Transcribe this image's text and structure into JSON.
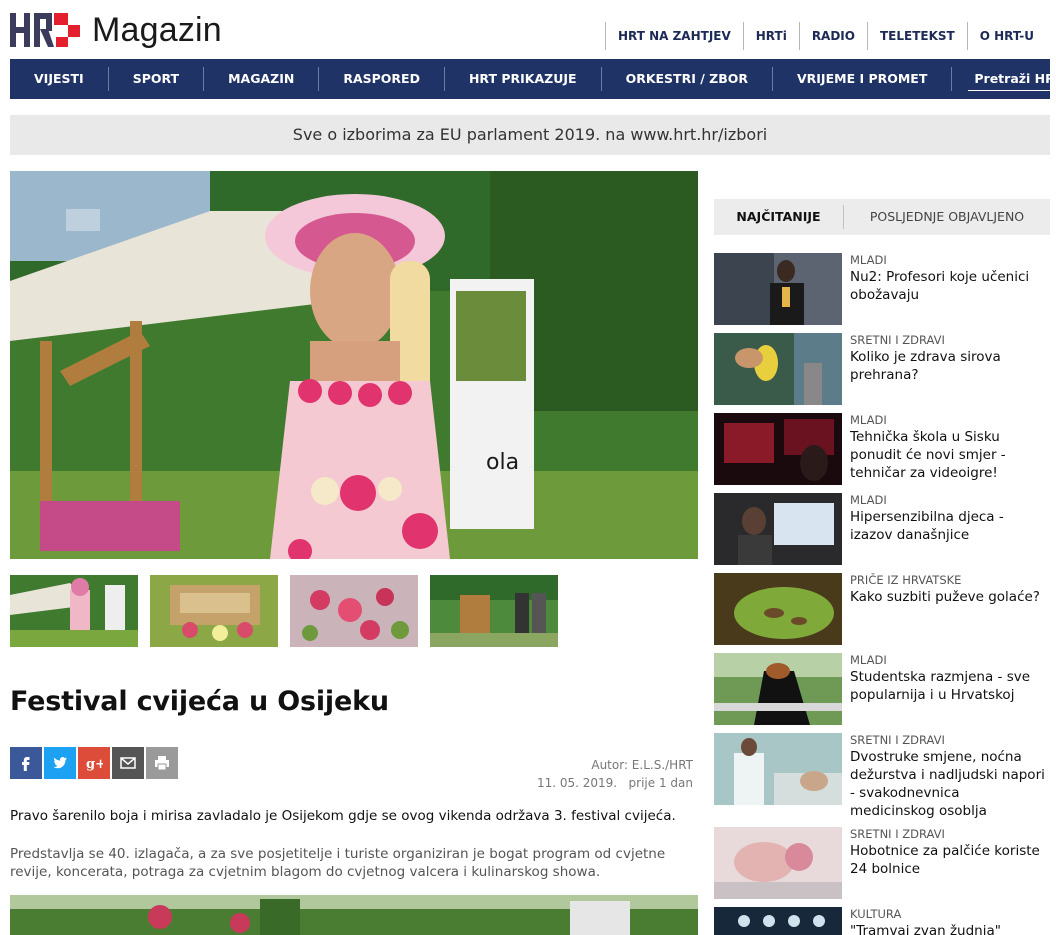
{
  "header": {
    "logo_text": "Magazin",
    "logo_mark": "HRT",
    "topnav": [
      "HRT NA ZAHTJEV",
      "HRTi",
      "RADIO",
      "TELETEKST",
      "O HRT-U"
    ]
  },
  "mainnav": {
    "items": [
      "VIJESTI",
      "SPORT",
      "MAGAZIN",
      "RASPORED",
      "HRT PRIKAZUJE",
      "ORKESTRI / ZBOR",
      "VRIJEME I PROMET"
    ],
    "search_placeholder": "Pretraži HRT"
  },
  "banner": {
    "text": "Sve o izborima za EU parlament 2019. na www.hrt.hr/izbori"
  },
  "article": {
    "title": "Festival cvijeća u Osijeku",
    "author": "Autor: E.L.S./HRT",
    "date": "11. 05. 2019.",
    "ago": "prije 1 dan",
    "lead": "Pravo šarenilo boja i mirisa zavladalo je Osijekom gdje se ovog vikenda održava 3. festival cvijeća.",
    "body": "Predstavlja se 40. izlagača, a za sve posjetitelje i turiste organiziran je bogat program od cvjetne revije, koncerata, potraga za cvjetnim blagom do cvjetnog valcera i kulinarskog showa."
  },
  "share": {
    "icons": [
      "facebook-icon",
      "twitter-icon",
      "google-plus-icon",
      "email-icon",
      "print-icon"
    ]
  },
  "sidebar": {
    "tabs": [
      "NAJČITANIJE",
      "POSLJEDNJE OBJAVLJENO"
    ],
    "items": [
      {
        "category": "MLADI",
        "title": "Nu2: Profesori koje učenici obožavaju"
      },
      {
        "category": "SRETNI I ZDRAVI",
        "title": "Koliko je zdrava sirova prehrana?"
      },
      {
        "category": "MLADI",
        "title": "Tehnička škola u Sisku ponudit će novi smjer - tehničar za videoigre!"
      },
      {
        "category": "MLADI",
        "title": "Hipersenzibilna djeca - izazov današnjice"
      },
      {
        "category": "PRIČE IZ HRVATSKE",
        "title": "Kako suzbiti puževe golaće?"
      },
      {
        "category": "MLADI",
        "title": "Studentska razmjena - sve popularnija i u Hrvatskoj"
      },
      {
        "category": "SRETNI I ZDRAVI",
        "title": "Dvostruke smjene, noćna dežurstva i nadljudski napori - svakodnevnica medicinskog osoblja"
      },
      {
        "category": "SRETNI I ZDRAVI",
        "title": "Hobotnice za palčiće koriste 24 bolnice"
      },
      {
        "category": "KULTURA",
        "title": "\"Tramvaj zvan žudnja\""
      }
    ]
  },
  "colors": {
    "nav_bg": "#1f3366",
    "banner_bg": "#e9e9e9",
    "logo_red": "#e4202e"
  }
}
